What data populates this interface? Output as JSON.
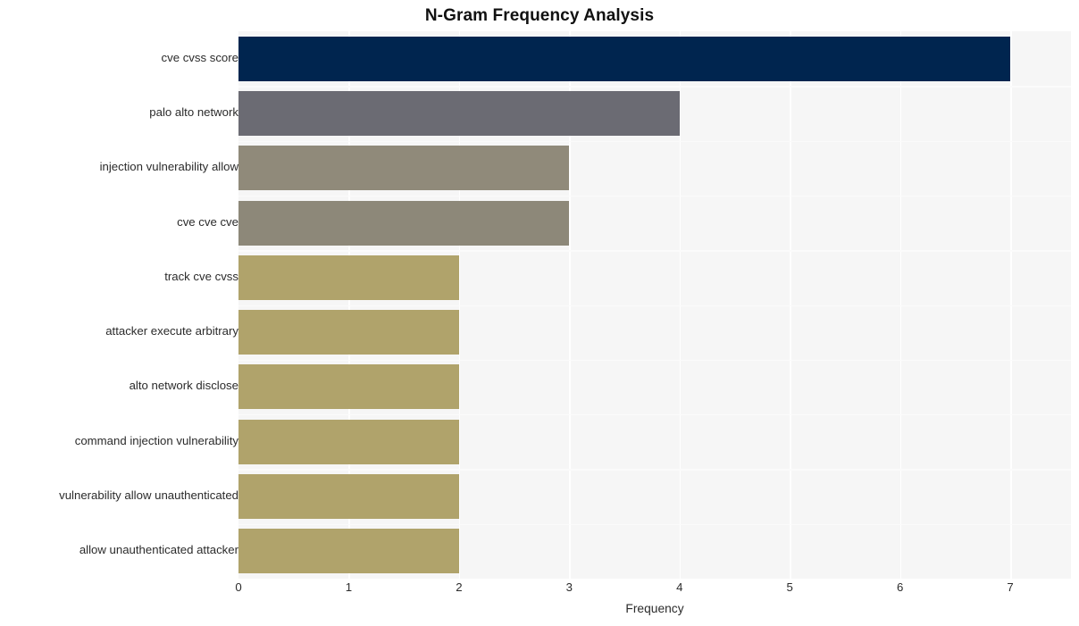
{
  "chart_data": {
    "type": "bar",
    "orientation": "horizontal",
    "title": "N-Gram Frequency Analysis",
    "xlabel": "Frequency",
    "ylabel": "",
    "xlim": [
      0,
      7.55
    ],
    "ylim": [
      0,
      10
    ],
    "grid": true,
    "legend": null,
    "xticks": [
      0,
      1,
      2,
      3,
      4,
      5,
      6,
      7
    ],
    "xtick_labels": [
      "0",
      "1",
      "2",
      "3",
      "4",
      "5",
      "6",
      "7"
    ],
    "categories": [
      "cve cvss score",
      "palo alto network",
      "injection vulnerability allow",
      "cve cve cve",
      "track cve cvss",
      "attacker execute arbitrary",
      "alto network disclose",
      "command injection vulnerability",
      "vulnerability allow unauthenticated",
      "allow unauthenticated attacker"
    ],
    "values": [
      7,
      4,
      3,
      3,
      2,
      2,
      2,
      2,
      2,
      2
    ],
    "bar_colors": [
      "#00254f",
      "#6b6b73",
      "#908a7a",
      "#8d8879",
      "#b0a36b",
      "#b0a36b",
      "#b0a36b",
      "#b0a36b",
      "#b0a36b",
      "#b0a36b"
    ],
    "plot_background": "#f6f6f6",
    "gridline_color": "#ffffff",
    "figure_background": "#ffffff",
    "text_color": "#2b2b2b",
    "title_color": "#111111"
  }
}
